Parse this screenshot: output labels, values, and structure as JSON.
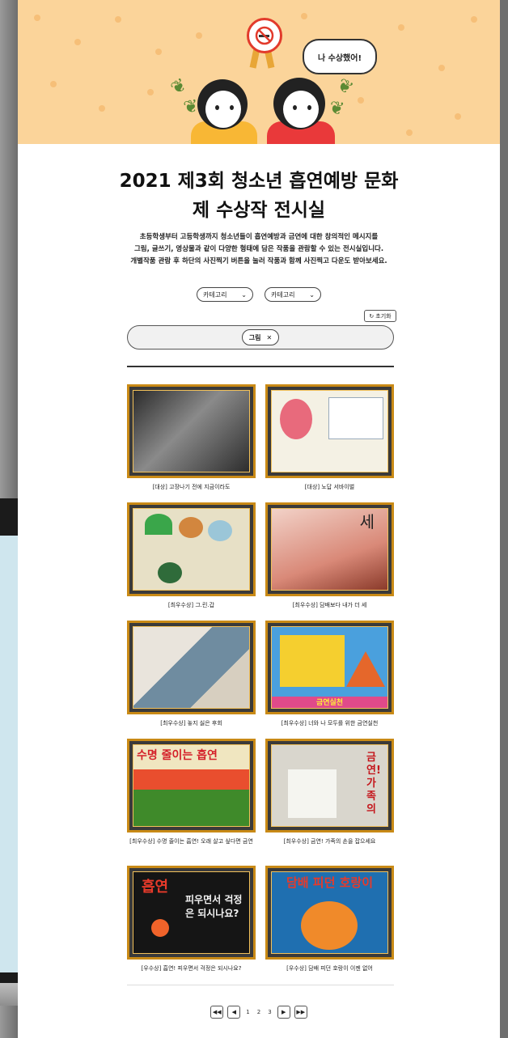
{
  "hero": {
    "bubble_text": "나 수상했어!",
    "badge_icon": "no-smoking-icon",
    "colors": {
      "background": "#fbd49a",
      "dots": "#f6bf78",
      "badge_border": "#e23a2b"
    }
  },
  "title_line1": "2021 제3회 청소년 흡연예방 문화",
  "title_line2": "제 수상작 전시실",
  "description": [
    "초등학생부터 고등학생까지 청소년들이 흡연예방과 금연에 대한 창의적인 메시지를",
    "그림, 글쓰기, 영상물과 같이 다양한 형태에 담은 작품을 관람할 수 있는 전시실입니다.",
    "개별작품 관람 후 하단의 사진찍기 버튼을 눌러 작품과 함께 사진찍고 다운도 받아보세요."
  ],
  "filters": {
    "select1": "카테고리",
    "select2": "카테고리",
    "reset_label": "초기화",
    "active_chip": "그림"
  },
  "artworks": [
    {
      "caption": "[대상] 고장나기 전에 지금이라도",
      "color": "#5a5a5a"
    },
    {
      "caption": "[대상] 노답 서바이벌",
      "color": "#f4f1e4"
    },
    {
      "caption": "[최우수상] 그.린.갑",
      "color": "#e7e0c6"
    },
    {
      "caption": "[최우수상] 담배보다 내가 더 세",
      "color": "#d98978"
    },
    {
      "caption": "[최우수상] 놓지 싫은 후회",
      "color": "#6f8ca0"
    },
    {
      "caption": "[최우수상] 너와 나 모두를 위한 금연실천",
      "color": "#f5cf2f"
    },
    {
      "caption": "[최우수상] 수명 줄이는 흡연! 오래 살고 싶다면 금연",
      "color": "#e94e2e"
    },
    {
      "caption": "[최우수상] 금연! 가족의 손을 잡으세요",
      "color": "#d9d6cd"
    },
    {
      "caption": "[우수상] 흡연! 피우면서 걱정은 되시나요?",
      "color": "#151515"
    },
    {
      "caption": "[우수상] 담배 피던 호랑이 이젠 없어",
      "color": "#1f6fb0"
    }
  ],
  "art_text": {
    "a7": "수명 줄이는 흡연",
    "a8": "금연!가족의",
    "a9_1": "흡연",
    "a9_2": "피우면서 걱정은 되시나요?",
    "a10": "담배 피던 호랑이",
    "a4": "세",
    "a6": "금연실천"
  },
  "pagination": {
    "pages": [
      "1",
      "2",
      "3"
    ],
    "first": "◀◀",
    "prev": "◀",
    "next": "▶",
    "last": "▶▶"
  }
}
